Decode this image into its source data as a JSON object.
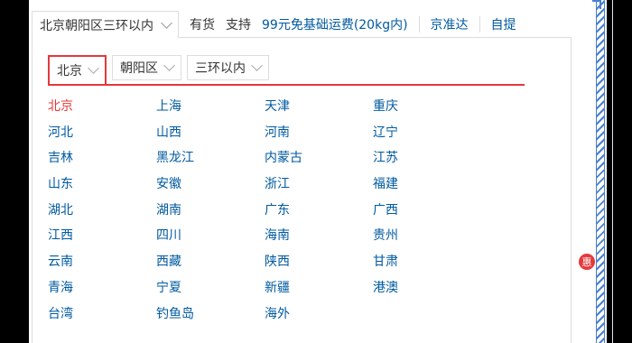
{
  "topbar": {
    "address": "北京朝阳区三环以内",
    "stock": "有货",
    "support": "支持",
    "shipping": "99元免基础运费(20kg内)",
    "delivery": "京准达",
    "pickup": "自提"
  },
  "tabs": [
    {
      "label": "北京"
    },
    {
      "label": "朝阳区"
    },
    {
      "label": "三环以内"
    }
  ],
  "regions": [
    "北京",
    "上海",
    "天津",
    "重庆",
    "河北",
    "山西",
    "河南",
    "辽宁",
    "吉林",
    "黑龙江",
    "内蒙古",
    "江苏",
    "山东",
    "安徽",
    "浙江",
    "福建",
    "湖北",
    "湖南",
    "广东",
    "广西",
    "江西",
    "四川",
    "海南",
    "贵州",
    "云南",
    "西藏",
    "陕西",
    "甘肃",
    "青海",
    "宁夏",
    "新疆",
    "港澳",
    "台湾",
    "钓鱼岛",
    "海外"
  ],
  "selected_region": "北京",
  "badge": "惠",
  "colors": {
    "accent": "#e4393c",
    "link": "#005aa0"
  }
}
